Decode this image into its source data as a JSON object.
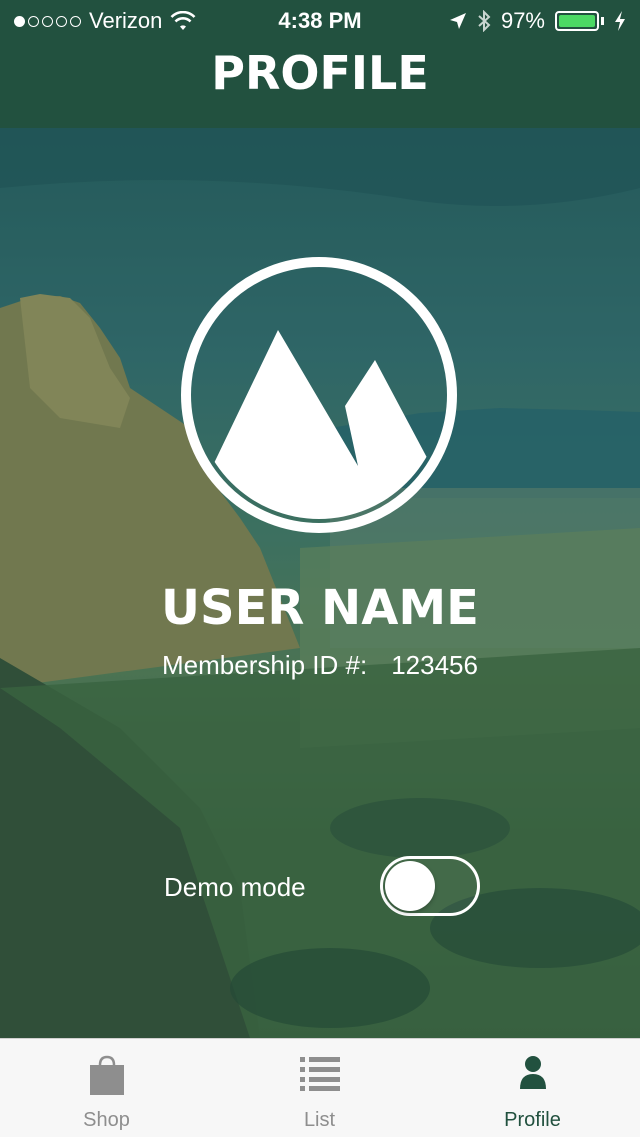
{
  "status_bar": {
    "carrier": "Verizon",
    "time": "4:38 PM",
    "battery": "97%"
  },
  "header": {
    "title": "PROFILE"
  },
  "profile": {
    "user_name": "USER NAME",
    "membership_label": "Membership ID #:",
    "membership_id": "123456",
    "demo_mode_label": "Demo mode",
    "demo_mode_on": false
  },
  "tabs": [
    {
      "label": "Shop",
      "icon": "shopping-bag-icon",
      "active": false
    },
    {
      "label": "List",
      "icon": "list-icon",
      "active": false
    },
    {
      "label": "Profile",
      "icon": "person-icon",
      "active": true
    }
  ],
  "colors": {
    "header_bg": "#22513f",
    "active_tab": "#22513f",
    "inactive_tab": "#8e8e8e",
    "battery": "#4cd964"
  }
}
